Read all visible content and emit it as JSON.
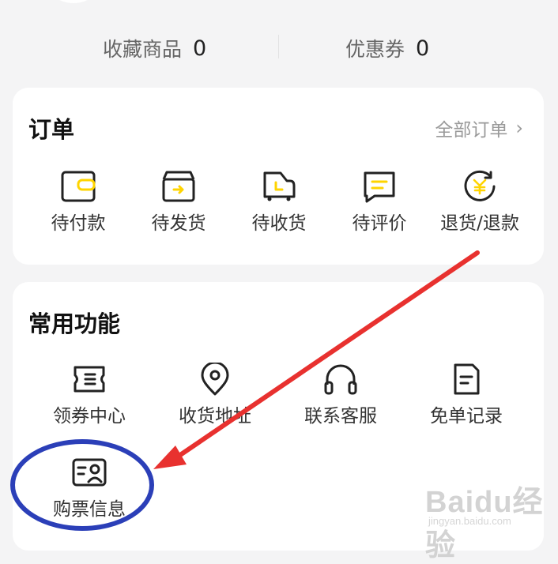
{
  "stats": {
    "favorites_label": "收藏商品",
    "favorites_count": "0",
    "coupons_label": "优惠券",
    "coupons_count": "0"
  },
  "orders": {
    "title": "订单",
    "all_label": "全部订单",
    "items": [
      {
        "label": "待付款",
        "icon": "wallet-icon"
      },
      {
        "label": "待发货",
        "icon": "box-icon"
      },
      {
        "label": "待收货",
        "icon": "delivery-icon"
      },
      {
        "label": "待评价",
        "icon": "comment-icon"
      },
      {
        "label": "退货/退款",
        "icon": "refund-icon"
      }
    ]
  },
  "tools": {
    "title": "常用功能",
    "items": [
      {
        "label": "领券中心",
        "icon": "ticket-icon"
      },
      {
        "label": "收货地址",
        "icon": "location-icon"
      },
      {
        "label": "联系客服",
        "icon": "headset-icon"
      },
      {
        "label": "免单记录",
        "icon": "document-icon"
      },
      {
        "label": "购票信息",
        "icon": "id-card-icon"
      }
    ]
  },
  "annotation": {
    "arrow_color": "#e8312f",
    "circle_color": "#2b3fb8"
  },
  "watermark": {
    "text": "Baidu经验",
    "sub": "jingyan.baidu.com"
  },
  "colors": {
    "accent": "#ffd400",
    "icon_stroke": "#222222"
  }
}
